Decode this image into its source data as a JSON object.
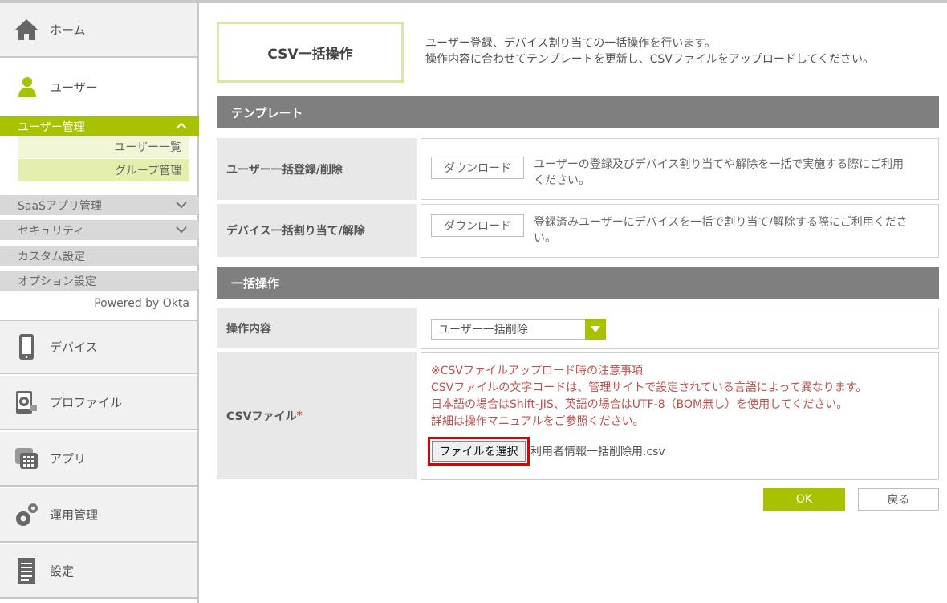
{
  "sidebar": {
    "home_label": "ホーム",
    "user_label": "ユーザー",
    "user_submenu": {
      "active_label": "ユーザー管理",
      "items": [
        "ユーザー一覧",
        "グループ管理"
      ]
    },
    "subs": [
      {
        "label": "SaaSアプリ管理",
        "expandable": true
      },
      {
        "label": "セキュリティ",
        "expandable": true
      },
      {
        "label": "カスタム設定",
        "expandable": false
      },
      {
        "label": "オプション設定",
        "expandable": false
      }
    ],
    "powered_by": "Powered by Okta",
    "device_label": "デバイス",
    "profile_label": "プロファイル",
    "app_label": "アプリ",
    "ops_label": "運用管理",
    "settings_label": "設定"
  },
  "page": {
    "title": "CSV一括操作",
    "desc_line1": "ユーザー登録、デバイス割り当ての一括操作を行います。",
    "desc_line2": "操作内容に合わせてテンプレートを更新し、CSVファイルをアップロードしてください。"
  },
  "template": {
    "header": "テンプレート",
    "rows": [
      {
        "label": "ユーザー一括登録/削除",
        "button": "ダウンロード",
        "desc_line1": "ユーザーの登録及びデバイス割り当てや解除を一括で実施する際にご利用",
        "desc_line2": "ください。"
      },
      {
        "label": "デバイス一括割り当て/解除",
        "button": "ダウンロード",
        "desc_line1": "登録済みユーザーにデバイスを一括で割り当て/解除する際にご利用くださ",
        "desc_line2": "い。"
      }
    ]
  },
  "bulk": {
    "header": "一括操作",
    "operation_label": "操作内容",
    "operation_value": "ユーザー一括削除",
    "csv_label": "CSVファイル",
    "required_mark": "*",
    "notice": [
      "※CSVファイルアップロード時の注意事項",
      "CSVファイルの文字コードは、管理サイトで設定されている言語によって異なります。",
      "日本語の場合はShift-JIS、英語の場合はUTF-8（BOM無し）を使用してください。",
      "詳細は操作マニュアルをご参照ください。"
    ],
    "file_button": "ファイルを選択",
    "file_name": "利用者情報一括削除用.csv"
  },
  "actions": {
    "ok": "OK",
    "back": "戻る"
  },
  "colors": {
    "accent": "#a8c200",
    "section": "#7f7f7f",
    "notice": "#c0504d",
    "highlight": "#e00000"
  }
}
